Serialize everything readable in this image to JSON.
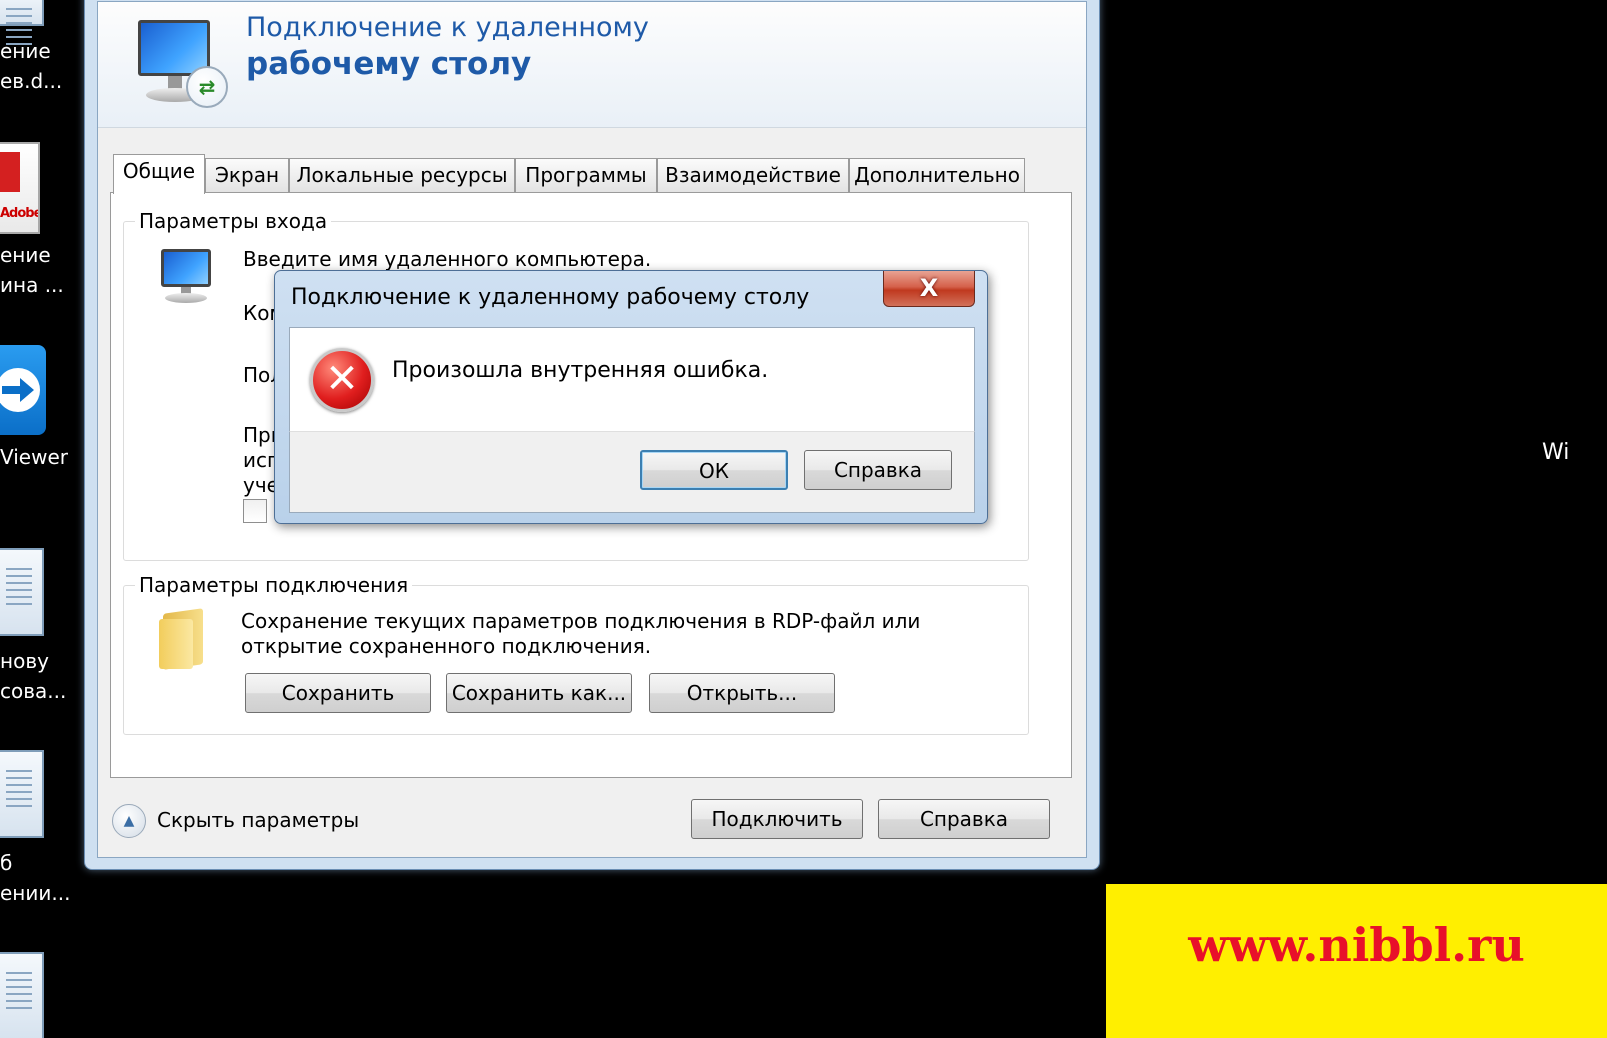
{
  "desktop": {
    "icons": [
      {
        "line1": "ение",
        "line2": "ев.d..."
      },
      {
        "line1": "ение",
        "line2": "ина ..."
      },
      {
        "line1": "Viewer"
      },
      {
        "line1": "нову",
        "line2": "сова..."
      },
      {
        "line1": "б",
        "line2": "ении..."
      }
    ],
    "pdf_label": "Adobe",
    "right_label": "Wi"
  },
  "main_window": {
    "banner_line1": "Подключение к удаленному",
    "banner_line2": "рабочему столу",
    "tabs": [
      {
        "label": "Общие",
        "active": true
      },
      {
        "label": "Экран"
      },
      {
        "label": "Локальные ресурсы"
      },
      {
        "label": "Программы"
      },
      {
        "label": "Взаимодействие"
      },
      {
        "label": "Дополнительно"
      }
    ],
    "login_group": {
      "title": "Параметры входа",
      "prompt": "Введите имя удаленного компьютера.",
      "computer_label_partial": "Ком",
      "user_label_partial": "Пол",
      "note_partial_1": "При",
      "note_partial_2": "исп",
      "note_partial_3": "уче"
    },
    "connection_group": {
      "title": "Параметры подключения",
      "desc_line1": "Сохранение текущих параметров подключения в RDP-файл или",
      "desc_line2": "открытие сохраненного подключения.",
      "save_label": "Сохранить",
      "save_as_label": "Сохранить как...",
      "open_label": "Открыть..."
    },
    "hide_params_label": "Скрыть параметры",
    "connect_label": "Подключить",
    "help_label": "Справка"
  },
  "error_dialog": {
    "title": "Подключение к удаленному рабочему столу",
    "close_glyph": "X",
    "message": "Произошла внутренняя ошибка.",
    "ok_label": "ОК",
    "help_label": "Справка"
  },
  "watermark": {
    "text": "www.nibbl.ru",
    "background": "#ffef00",
    "color": "#e8102a"
  }
}
